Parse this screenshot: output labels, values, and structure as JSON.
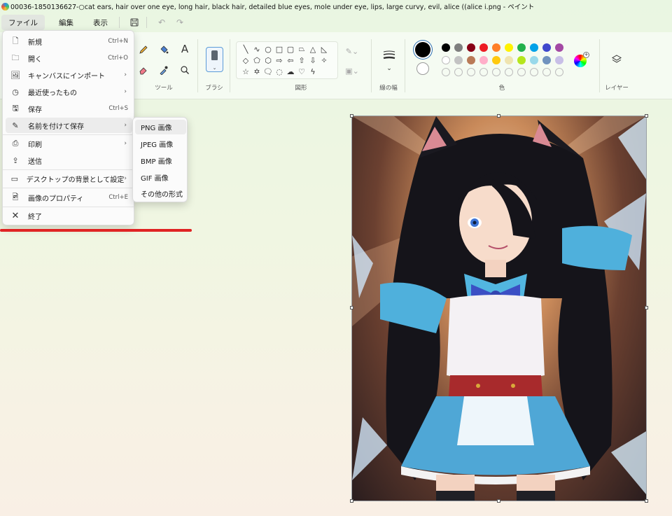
{
  "window": {
    "title": "00036-1850136627-○cat ears, hair over one eye, long hair, black hair, detailed blue eyes, mole under eye, lips, large curvy, evil, alice ((alice i.png - ペイント"
  },
  "menubar": {
    "items": [
      {
        "label": "ファイル"
      },
      {
        "label": "編集"
      },
      {
        "label": "表示"
      }
    ]
  },
  "ribbon": {
    "groups": {
      "tools": "ツール",
      "brush": "ブラシ",
      "shapes": "図形",
      "size": "線の幅",
      "colors": "色",
      "layers": "レイヤー"
    },
    "text_tool": "A"
  },
  "palette": {
    "row1": [
      "#000000",
      "#7f7f7f",
      "#880015",
      "#ed1c24",
      "#ff7f27",
      "#fff200",
      "#22b14c",
      "#00a2e8",
      "#3f48cc",
      "#a349a4"
    ],
    "row2": [
      "#ffffff",
      "#c3c3c3",
      "#b97a57",
      "#ffaec9",
      "#ffc90e",
      "#efe4b0",
      "#b5e61d",
      "#99d9ea",
      "#7092be",
      "#c8bfe7"
    ],
    "primary": "#000000",
    "secondary": "#ffffff"
  },
  "file_menu": {
    "items": [
      {
        "icon": "new-file-icon",
        "label": "新規",
        "shortcut": "Ctrl+N"
      },
      {
        "icon": "open-folder-icon",
        "label": "開く",
        "shortcut": "Ctrl+O"
      },
      {
        "icon": "import-icon",
        "label": "キャンバスにインポート",
        "shortcut": ""
      },
      {
        "icon": "clock-icon",
        "label": "最近使ったもの",
        "shortcut": ""
      },
      {
        "icon": "save-icon",
        "label": "保存",
        "shortcut": "Ctrl+S"
      },
      {
        "icon": "save-as-icon",
        "label": "名前を付けて保存",
        "shortcut": ""
      },
      {
        "icon": "print-icon",
        "label": "印刷",
        "shortcut": ""
      },
      {
        "icon": "share-icon",
        "label": "送信",
        "shortcut": ""
      },
      {
        "icon": "desktop-icon",
        "label": "デスクトップの背景として設定",
        "shortcut": ""
      },
      {
        "icon": "properties-icon",
        "label": "画像のプロパティ",
        "shortcut": "Ctrl+E"
      },
      {
        "icon": "close-icon",
        "label": "終了",
        "shortcut": ""
      }
    ]
  },
  "save_as_submenu": {
    "items": [
      {
        "label": "PNG 画像"
      },
      {
        "label": "JPEG 画像"
      },
      {
        "label": "BMP 画像"
      },
      {
        "label": "GIF 画像"
      },
      {
        "label": "その他の形式"
      }
    ]
  }
}
